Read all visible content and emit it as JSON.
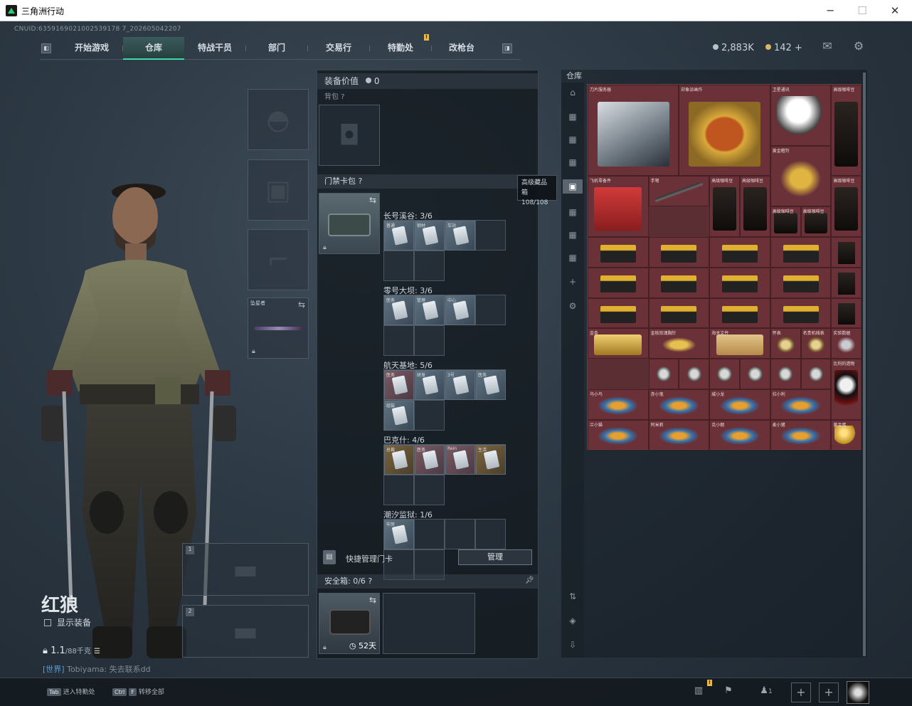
{
  "window": {
    "title": "三角洲行动",
    "minimize": "─",
    "maximize": "☐",
    "close": "✕"
  },
  "uid": "CNUID:6359169021002539178 7_202605042207",
  "nav": {
    "tabs": [
      "开始游戏",
      "仓库",
      "特战干员",
      "部门",
      "交易行",
      "特勤处",
      "改枪台"
    ],
    "active_index": 1,
    "badge": "!"
  },
  "currency": {
    "silver": "2,883K",
    "gold": "142 +"
  },
  "character": {
    "name": "红狼",
    "show_equipment": "显示装备",
    "weight": "1.1",
    "weight_max": "/88千克"
  },
  "chat": {
    "channel": "[世界]",
    "text": "Tobiyama: 失去联系dd"
  },
  "loadout": {
    "pistol_slot_label": "",
    "melee_name": "坠星者",
    "weapon_slot_1": "1",
    "weapon_slot_2": "2"
  },
  "mid": {
    "equip_value_label": "装备价值",
    "equip_value": "0",
    "backpack_label": "背包 ?",
    "keycard_label": "门禁卡包 ?",
    "tooltip": {
      "title": "高级藏品箱",
      "value": "108/108"
    },
    "zones": [
      {
        "name": "长号溪谷: 3/6",
        "cards": [
          "普通",
          "钢材",
          "车站"
        ]
      },
      {
        "name": "零号大坝: 3/6",
        "cards": [
          "医务",
          "管理",
          "中心"
        ]
      },
      {
        "name": "航天基地: 5/6",
        "cards": [
          "医务",
          "研发",
          "3号",
          "医务",
          "组装"
        ]
      },
      {
        "name": "巴克什: 4/6",
        "cards": [
          "总裁",
          "医务",
          "Rein",
          "生活"
        ]
      },
      {
        "name": "潮汐监狱: 1/6",
        "cards": [
          "牢房"
        ]
      }
    ],
    "quick_manage": "快捷管理门卡",
    "manage_btn": "管理",
    "safebox_label": "安全箱: 0/6 ?",
    "safebox_days": "52天"
  },
  "stash": {
    "title": "仓库",
    "items": [
      {
        "name": "刀片服务器",
        "kind": "server"
      },
      {
        "name": "印象派画作",
        "kind": "painting"
      },
      {
        "name": "卫星通讯",
        "kind": "dish"
      },
      {
        "name": "高级咖啡豆",
        "kind": "coffee"
      },
      {
        "name": "黄金瞪羚",
        "kind": "deer"
      },
      {
        "name": "高级咖啡豆",
        "kind": "coffee"
      },
      {
        "name": "飞机零备件",
        "kind": "redcase"
      },
      {
        "name": "手弩",
        "kind": "crossbow"
      },
      {
        "name": "高级咖啡豆",
        "kind": "coffee"
      },
      {
        "name": "高级咖啡豆",
        "kind": "coffee"
      },
      {
        "name": "高级咖啡豆",
        "kind": "coffee"
      },
      {
        "name": "高级咖啡豆",
        "kind": "coffee"
      },
      {
        "name": "金条",
        "kind": "goldbar"
      },
      {
        "name": "金枝玫瑰胸针",
        "kind": "rose"
      },
      {
        "name": "海关文件",
        "kind": "docs"
      },
      {
        "name": "怀表",
        "kind": "watch"
      },
      {
        "name": "名贵机械表",
        "kind": "watch"
      },
      {
        "name": "实验数据",
        "kind": "misc"
      },
      {
        "name": "比利的遗物",
        "kind": "puppet"
      },
      {
        "name": "乌小鸟",
        "kind": "figure"
      },
      {
        "name": "赤小鬼",
        "kind": "figure"
      },
      {
        "name": "威小龙",
        "kind": "figure"
      },
      {
        "name": "拉小利",
        "kind": "figure"
      },
      {
        "name": "兰小猫",
        "kind": "figure"
      },
      {
        "name": "阿米莉",
        "kind": "figure"
      },
      {
        "name": "克小朗",
        "kind": "figure"
      },
      {
        "name": "麦小猪",
        "kind": "figure"
      },
      {
        "name": "黄金蛋",
        "kind": "egg"
      }
    ]
  },
  "bottom": {
    "tab_key": "Tab",
    "tab_text": "进入特勤处",
    "ctrl_key": "Ctrl",
    "f_key": "F",
    "ctrl_text": "转移全部",
    "friends": "1"
  }
}
